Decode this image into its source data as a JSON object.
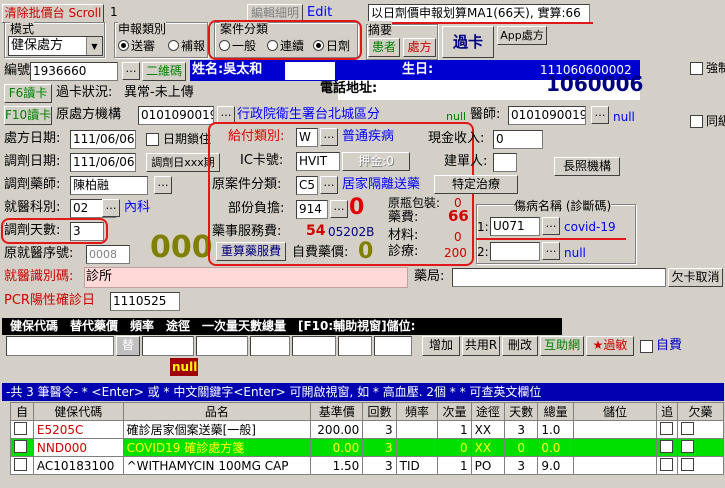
{
  "top": {
    "clear_btn": "清除批價台 Scroll",
    "counter": "1",
    "edit_btn1": "編輯細明",
    "edit_btn2": "Edit",
    "status": "以日劑價申報划算MA1(66天), 實算:66"
  },
  "mode": {
    "label": "模式",
    "value": "健保處方"
  },
  "report_type": {
    "label": "申報類別",
    "options": [
      "送審",
      "補報"
    ],
    "selected": "送審"
  },
  "case_cat": {
    "label": "案件分類",
    "options": [
      "一般",
      "連續",
      "日劑"
    ],
    "selected": "日劑"
  },
  "summary": {
    "label": "摘要",
    "patient": "患者",
    "rx": "處方"
  },
  "guoka_btn": "過卡",
  "app_rx_btn": "App處方",
  "record": {
    "label": "編號",
    "value": "1936660",
    "new_btn": "二維碼"
  },
  "patient": {
    "name_label": "姓名:吳太和",
    "birth_label": "生日:",
    "id_no": "111060600002",
    "addr_label": "電話地址:",
    "total": "1060006"
  },
  "f6": {
    "btn": "F6讀卡",
    "label": "過卡狀況:",
    "value": "異常-未上傳"
  },
  "f10": {
    "btn": "F10讀卡",
    "label": "原處方機構",
    "code": "0101090019",
    "org_name": "行政院衛生署台北城區分",
    "null1": "null",
    "doctor_label": "醫師:",
    "doctor_code": "0101090019",
    "null2": "null"
  },
  "dates": {
    "rx_date_label": "處方日期:",
    "rx_date": "111/06/06",
    "day_lock": "日期鎖住",
    "dispense_label": "調劑日期:",
    "dispense_date": "111/06/06",
    "dispense_btn": "調劑日xxx期"
  },
  "pharmacist": {
    "label": "調劑藥師:",
    "value": "陳柏融"
  },
  "dept": {
    "label": "就醫科別:",
    "code": "02",
    "name": "內科"
  },
  "days": {
    "label": "調劑天數:",
    "value": "3"
  },
  "seq": {
    "label": "原就醫序號:",
    "value": "0008",
    "big": "000"
  },
  "visit_id": {
    "label": "就醫識別碼:",
    "value": "診所"
  },
  "pcr": {
    "label": "PCR陽性確診日",
    "value": "1110525"
  },
  "center": {
    "give_type_label": "給付類別:",
    "give_type_code": "W",
    "give_type_name": "普通疾病",
    "ic_label": "IC卡號:",
    "ic_value": "HVIT",
    "deposit_btn": "押金:0",
    "orig_case_label": "原案件分類:",
    "orig_case_code": "C5",
    "orig_case_name": "居家隔離送藥",
    "copay_label": "部份負擔:",
    "copay_code": "914",
    "copay_value": "0",
    "service_label": "藥事服務費:",
    "service_value": "54",
    "service_code": "05202B",
    "recalc_btn": "重算藥服費",
    "self_label": "自費藥價:",
    "self_value": "0"
  },
  "cash": {
    "received_label": "現金收入:",
    "received_value": "0",
    "builder_label": "建單人:",
    "orig_pack_label": "原瓶包裝:",
    "orig_pack_value": "0",
    "drug_fee_label": "藥費:",
    "drug_fee_value": "66",
    "material_label": "材料:",
    "material_value": "0",
    "diag_label": "診療:",
    "diag_value": "200"
  },
  "right": {
    "long_btn": "長照機構",
    "special_btn": "特定治療",
    "disease_label": "傷病名稱 (診斷碼)",
    "d1_num": "1:",
    "d1_code": "U071",
    "d1_name": "covid-19",
    "d2_num": "2:",
    "d2_name": "null",
    "chk1": "強制",
    "chk2": "同級"
  },
  "pharmacy": {
    "label": "藥局:",
    "dup_btn": "欠卡取消"
  },
  "entry": {
    "header": "健保代碼　替代藥價　頻率　途徑　一次量天數總量　[F10:輔助視窗]儲位:",
    "add_btn": "增加",
    "share_btn": "共用R",
    "del_btn": "刪改",
    "interact_btn": "互助網",
    "allergy_btn": "★過敏",
    "self_chk": "自費",
    "null_tag": "null"
  },
  "hint": "-共 3 筆醫令- * <Enter> 或 * 中文關鍵字<Enter> 可開啟視窗, 如 * 高血壓. 2個 * * 可查英文欄位",
  "table": {
    "headers": [
      "自",
      "健保代碼",
      "品名",
      "基準價",
      "回數",
      "頻率",
      "次量",
      "途徑",
      "天數",
      "總量",
      "儲位",
      "追",
      "欠藥"
    ],
    "rows": [
      [
        "",
        "E5205C",
        "確診居家個案送藥[一般]",
        "200.00",
        "3",
        "",
        "1",
        "XX",
        "3",
        "1.0",
        "",
        "",
        ""
      ],
      [
        "",
        "NND000",
        "COVID19 確診處方箋",
        "0.00",
        "3",
        "",
        "0",
        "XX",
        "0",
        "0.0",
        "",
        "",
        ""
      ],
      [
        "",
        "AC10183100",
        "^WITHAMYCIN 100MG CAP",
        "1.50",
        "3",
        "TID",
        "1",
        "PO",
        "3",
        "9.0",
        "",
        "",
        ""
      ]
    ]
  }
}
